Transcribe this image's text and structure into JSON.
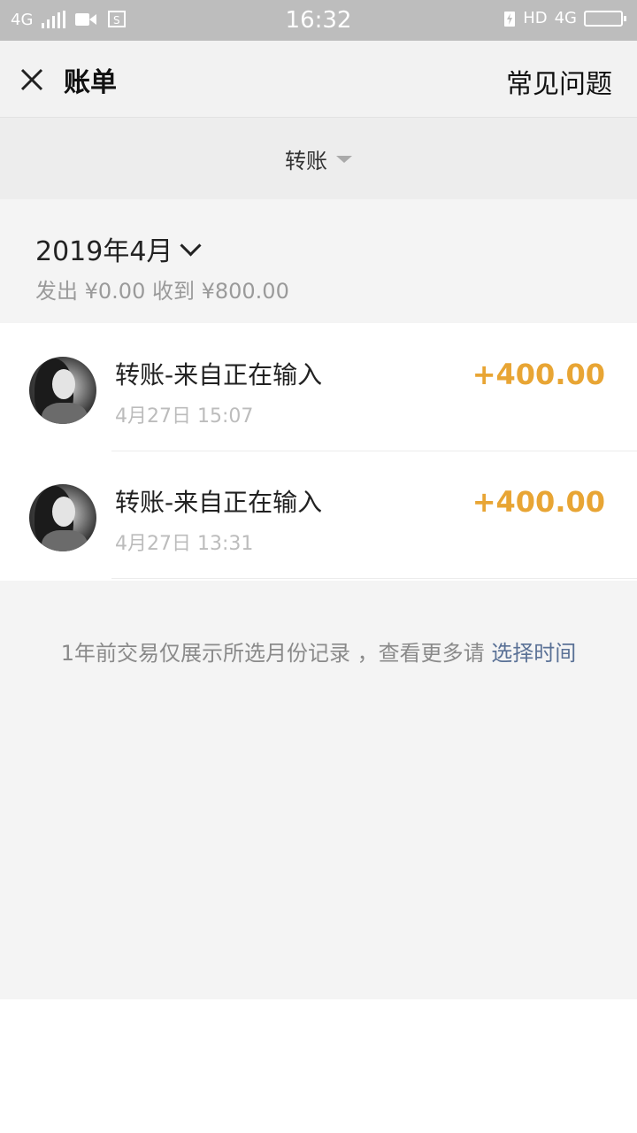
{
  "status_bar": {
    "network_left": "4G",
    "time": "16:32",
    "hd": "HD",
    "network_right": "4G",
    "icons": [
      "signal-icon",
      "video-icon",
      "screenshot-icon",
      "battery-saver-icon",
      "battery-icon"
    ]
  },
  "header": {
    "title": "账单",
    "faq": "常见问题"
  },
  "filter": {
    "label": "转账"
  },
  "month": {
    "label": "2019年4月",
    "summary": "发出 ¥0.00 收到 ¥800.00"
  },
  "transactions": [
    {
      "title": "转账-来自正在输入",
      "time": "4月27日 15:07",
      "amount": "+400.00"
    },
    {
      "title": "转账-来自正在输入",
      "time": "4月27日 13:31",
      "amount": "+400.00"
    }
  ],
  "footer": {
    "note": "1年前交易仅展示所选月份记录 ，查看更多请 ",
    "link": "选择时间"
  },
  "colors": {
    "amount": "#e8a534",
    "link": "#5a7196",
    "status_bar": "#bdbdbd"
  }
}
